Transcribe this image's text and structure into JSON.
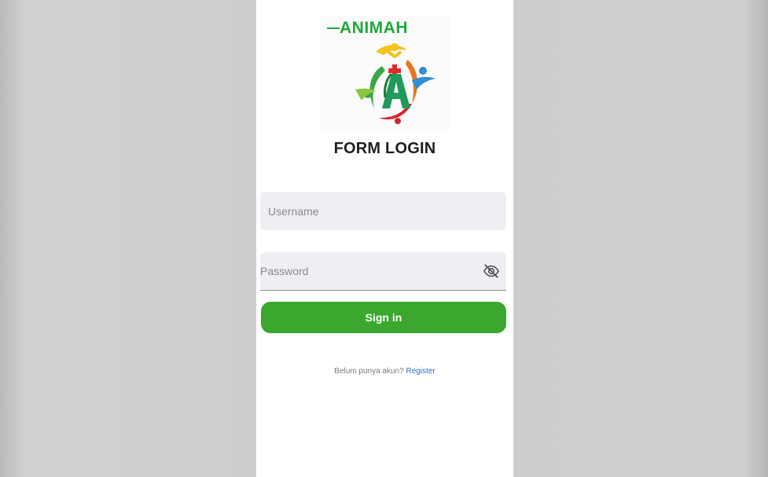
{
  "app": {
    "logo_text": "ANIMAH",
    "title": "FORM LOGIN"
  },
  "form": {
    "username_placeholder": "Username",
    "password_placeholder": "Password",
    "signin_label": "Sign in"
  },
  "footer": {
    "prompt": "Belum punya akun?",
    "register_label": "Register"
  },
  "icons": {
    "password_toggle": "eye-off-icon"
  },
  "colors": {
    "brand_green": "#3ba72f",
    "logo_green": "#1fa83a",
    "link_blue": "#2f6fd0",
    "field_bg": "#efeef3"
  }
}
